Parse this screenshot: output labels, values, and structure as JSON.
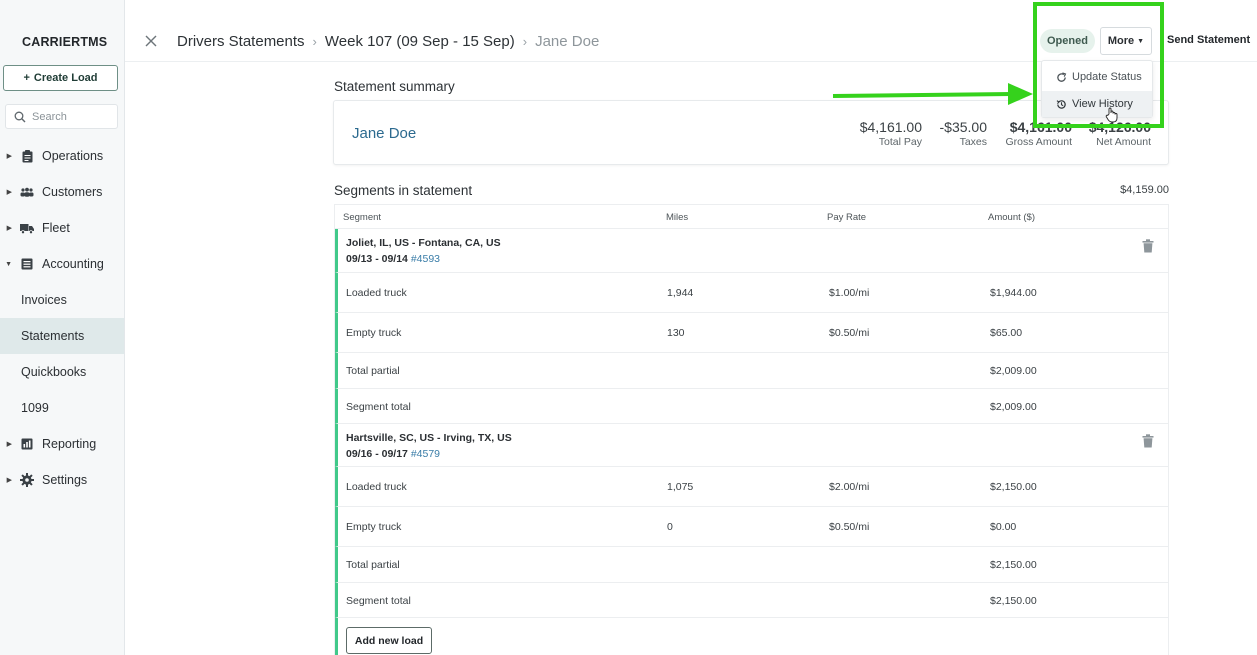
{
  "sidebar": {
    "brand": "CARRIERTMS",
    "create_load_label": "Create Load",
    "search_placeholder": "Search",
    "nav": {
      "operations": "Operations",
      "customers": "Customers",
      "fleet": "Fleet",
      "accounting": "Accounting",
      "invoices": "Invoices",
      "statements": "Statements",
      "quickbooks": "Quickbooks",
      "t1099": "1099",
      "reporting": "Reporting",
      "settings": "Settings"
    }
  },
  "header": {
    "breadcrumbs": [
      "Drivers Statements",
      "Week 107 (09 Sep - 15 Sep)",
      "Jane Doe"
    ],
    "status_badge": "Opened",
    "more_label": "More",
    "send_label": "Send Statement"
  },
  "dropdown": {
    "items": [
      "Update Status",
      "View History"
    ]
  },
  "summary": {
    "title": "Statement summary",
    "driver_name": "Jane Doe",
    "metrics": [
      {
        "value": "$4,161.00",
        "label": "Total Pay"
      },
      {
        "value": "-$35.00",
        "label": "Taxes"
      },
      {
        "value": "$4,161.00",
        "label": "Gross Amount"
      },
      {
        "value": "$4,126.00",
        "label": "Net Amount"
      }
    ]
  },
  "segments": {
    "title": "Segments in statement",
    "total": "$4,159.00",
    "columns": [
      "Segment",
      "Miles",
      "Pay Rate",
      "Amount ($)"
    ],
    "list": [
      {
        "route": "Joliet, IL, US - Fontana, CA, US",
        "dates": "09/13 - 09/14",
        "load_ref": "#4593",
        "rows": [
          {
            "label": "Loaded truck",
            "miles": "1,944",
            "rate": "$1.00/mi",
            "amount": "$1,944.00"
          },
          {
            "label": "Empty truck",
            "miles": "130",
            "rate": "$0.50/mi",
            "amount": "$65.00"
          },
          {
            "label": "Total partial",
            "miles": "",
            "rate": "",
            "amount": "$2,009.00"
          },
          {
            "label": "Segment total",
            "miles": "",
            "rate": "",
            "amount": "$2,009.00"
          }
        ]
      },
      {
        "route": "Hartsville, SC, US - Irving, TX, US",
        "dates": "09/16 - 09/17",
        "load_ref": "#4579",
        "rows": [
          {
            "label": "Loaded truck",
            "miles": "1,075",
            "rate": "$2.00/mi",
            "amount": "$2,150.00"
          },
          {
            "label": "Empty truck",
            "miles": "0",
            "rate": "$0.50/mi",
            "amount": "$0.00"
          },
          {
            "label": "Total partial",
            "miles": "",
            "rate": "",
            "amount": "$2,150.00"
          },
          {
            "label": "Segment total",
            "miles": "",
            "rate": "",
            "amount": "$2,150.00"
          }
        ]
      }
    ],
    "add_load_label": "Add new load"
  },
  "colors": {
    "accent_green": "#41c98a",
    "highlight": "#35d21c",
    "link_blue": "#2c6a8f"
  }
}
